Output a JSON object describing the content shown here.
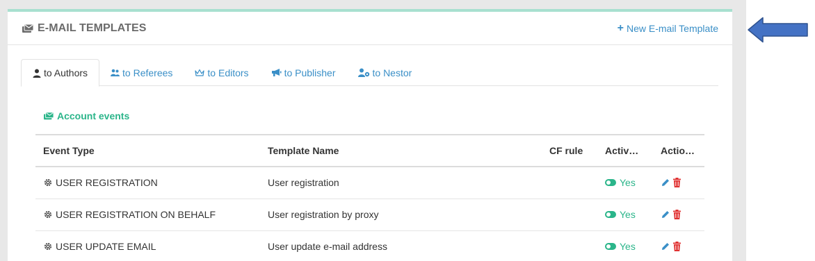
{
  "header": {
    "title": "E-MAIL TEMPLATES",
    "new_button_label": "New E-mail Template"
  },
  "tabs": [
    {
      "label": "to Authors",
      "active": true,
      "icon": "user-icon"
    },
    {
      "label": "to Referees",
      "active": false,
      "icon": "users-icon"
    },
    {
      "label": "to Editors",
      "active": false,
      "icon": "crown-icon"
    },
    {
      "label": "to Publisher",
      "active": false,
      "icon": "megaphone-icon"
    },
    {
      "label": "to Nestor",
      "active": false,
      "icon": "user-gear-icon"
    }
  ],
  "section": {
    "title": "Account events"
  },
  "table": {
    "columns": [
      "Event Type",
      "Template Name",
      "CF rule",
      "Activ…",
      "Actio…"
    ],
    "rows": [
      {
        "event": "USER REGISTRATION",
        "template": "User registration",
        "cf_rule": "",
        "active": "Yes"
      },
      {
        "event": "USER REGISTRATION ON BEHALF",
        "template": "User registration by proxy",
        "cf_rule": "",
        "active": "Yes"
      },
      {
        "event": "USER UPDATE EMAIL",
        "template": "User update e-mail address",
        "cf_rule": "",
        "active": "Yes"
      }
    ]
  },
  "colors": {
    "accent": "#3a8fc7",
    "green": "#2bb58a",
    "delete": "#e03131",
    "arrow": "#4472c4"
  }
}
